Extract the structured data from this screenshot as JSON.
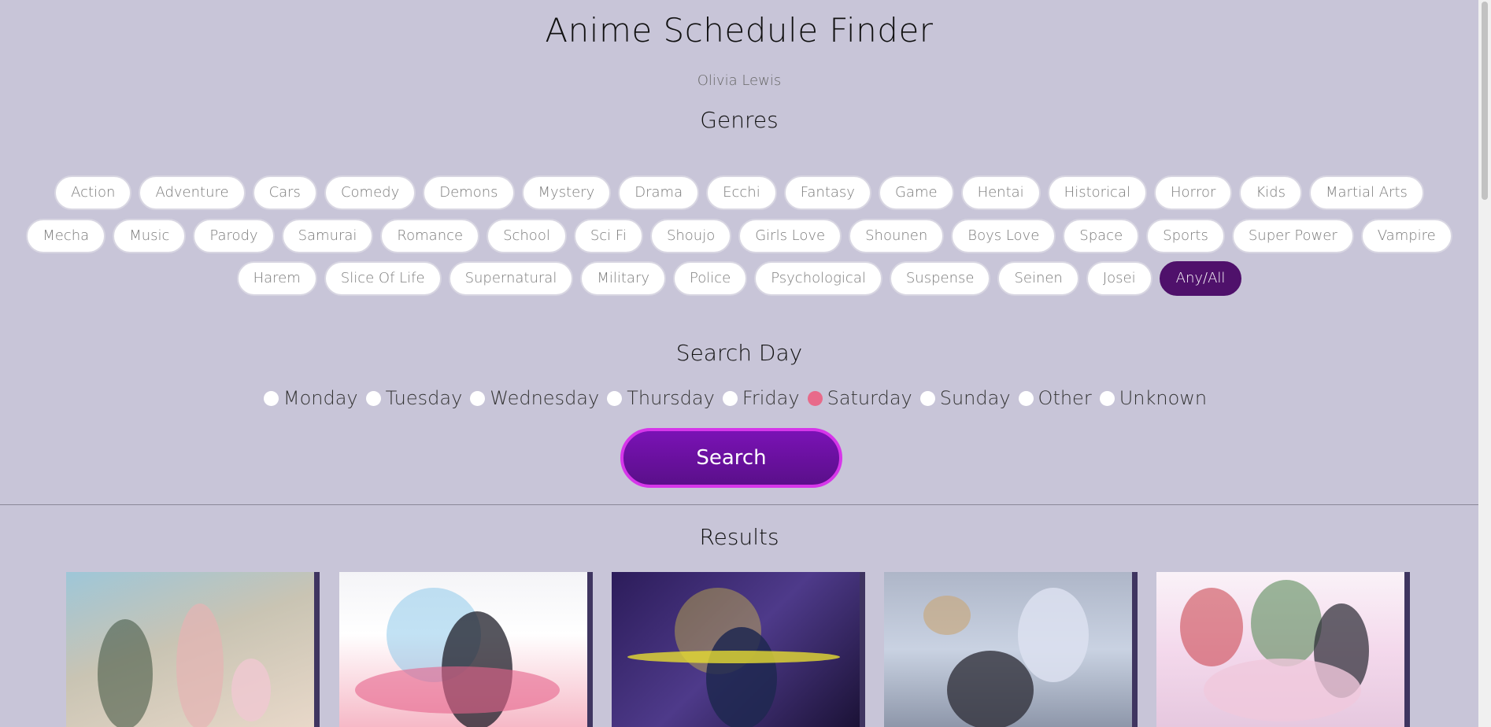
{
  "header": {
    "title": "Anime Schedule Finder",
    "author": "Olivia Lewis"
  },
  "genres": {
    "title": "Genres",
    "rows": [
      [
        "Action",
        "Adventure",
        "Cars",
        "Comedy",
        "Demons",
        "Mystery",
        "Drama",
        "Ecchi",
        "Fantasy",
        "Game",
        "Hentai",
        "Historical",
        "Horror",
        "Kids",
        "Martial Arts"
      ],
      [
        "Mecha",
        "Music",
        "Parody",
        "Samurai",
        "Romance",
        "School",
        "Sci Fi",
        "Shoujo",
        "Girls Love",
        "Shounen",
        "Boys Love",
        "Space",
        "Sports",
        "Super Power",
        "Vampire"
      ],
      [
        "Harem",
        "Slice Of Life",
        "Supernatural",
        "Military",
        "Police",
        "Psychological",
        "Suspense",
        "Seinen",
        "Josei",
        "Any/All"
      ]
    ],
    "selected": "Any/All"
  },
  "search_day": {
    "title": "Search Day",
    "options": [
      "Monday",
      "Tuesday",
      "Wednesday",
      "Thursday",
      "Friday",
      "Saturday",
      "Sunday",
      "Other",
      "Unknown"
    ],
    "selected": "Saturday"
  },
  "search_button": {
    "label": "Search"
  },
  "results": {
    "title": "Results",
    "cards": [
      {
        "poster": "poster-1"
      },
      {
        "poster": "poster-2"
      },
      {
        "poster": "poster-3"
      },
      {
        "poster": "poster-4"
      },
      {
        "poster": "poster-5"
      }
    ]
  },
  "colors": {
    "background": "#c8c5d8",
    "selected_chip": "#4f116b",
    "checked_radio": "#e86a8a",
    "search_button": "#6a10a0",
    "search_border": "#d636ea"
  }
}
